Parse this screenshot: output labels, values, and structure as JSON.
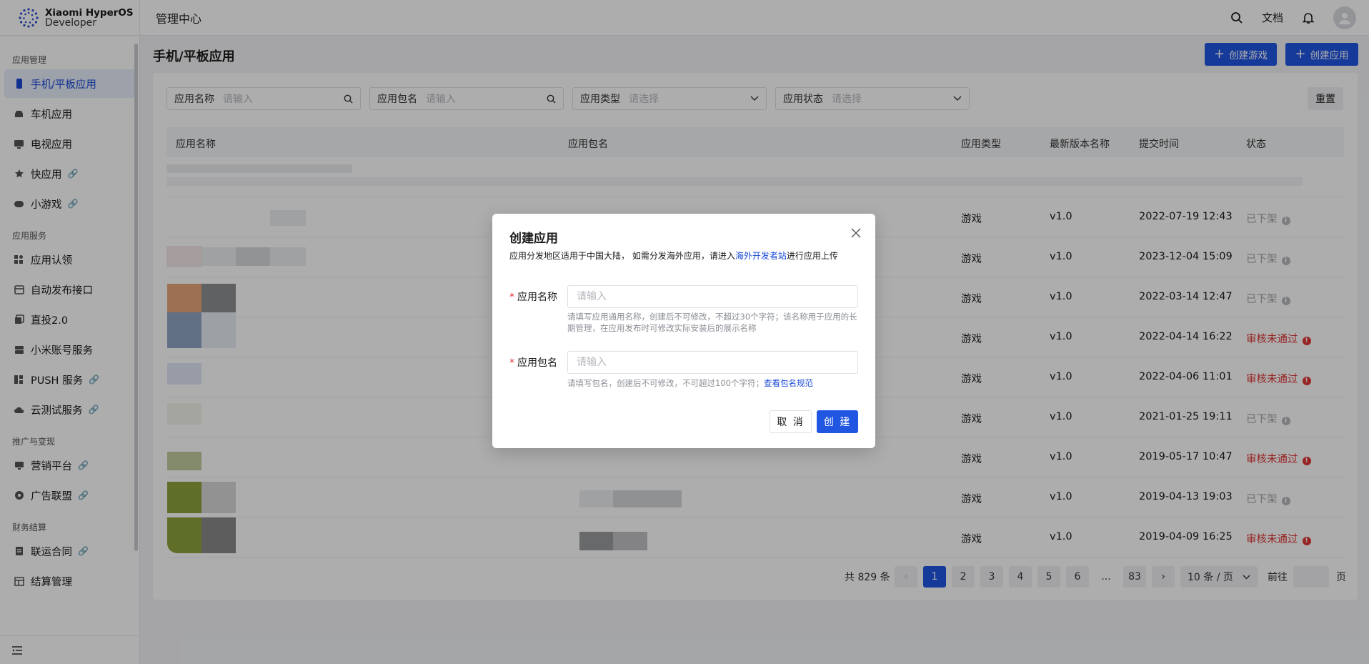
{
  "header": {
    "brand_line1": "Xiaomi HyperOS",
    "brand_line2": "Developer",
    "console_title": "管理中心",
    "docs_label": "文档",
    "icons": [
      "search-icon",
      "bell-icon",
      "avatar-icon"
    ]
  },
  "sidebar": {
    "groups": [
      {
        "title": "应用管理",
        "items": [
          {
            "label": "手机/平板应用",
            "icon": "phone-icon",
            "active": true,
            "external": false
          },
          {
            "label": "车机应用",
            "icon": "car-icon",
            "external": false
          },
          {
            "label": "电视应用",
            "icon": "tv-icon",
            "external": false
          },
          {
            "label": "快应用",
            "icon": "star-icon",
            "external": true
          },
          {
            "label": "小游戏",
            "icon": "gamepad-icon",
            "external": true
          }
        ]
      },
      {
        "title": "应用服务",
        "items": [
          {
            "label": "应用认领",
            "icon": "grid-icon",
            "external": false
          },
          {
            "label": "自动发布接口",
            "icon": "api-icon",
            "external": false
          },
          {
            "label": "直投2.0",
            "icon": "layers-icon",
            "external": false
          },
          {
            "label": "小米账号服务",
            "icon": "account-icon",
            "external": false
          },
          {
            "label": "PUSH 服务",
            "icon": "push-icon",
            "external": true
          },
          {
            "label": "云测试服务",
            "icon": "cloud-icon",
            "external": true
          }
        ]
      },
      {
        "title": "推广与变现",
        "items": [
          {
            "label": "营销平台",
            "icon": "monitor-icon",
            "external": true
          },
          {
            "label": "广告联盟",
            "icon": "ad-icon",
            "external": true
          }
        ]
      },
      {
        "title": "财务结算",
        "items": [
          {
            "label": "联运合同",
            "icon": "contract-icon",
            "external": true
          },
          {
            "label": "结算管理",
            "icon": "table-icon",
            "external": false
          }
        ]
      }
    ]
  },
  "main": {
    "title": "手机/平板应用",
    "create_game": "创建游戏",
    "create_app": "创建应用",
    "filters": {
      "app_name_label": "应用名称",
      "app_name_placeholder": "请输入",
      "package_label": "应用包名",
      "package_placeholder": "请输入",
      "type_label": "应用类型",
      "type_placeholder": "请选择",
      "status_label": "应用状态",
      "status_placeholder": "请选择",
      "reset": "重置"
    },
    "table": {
      "headers": [
        "应用名称",
        "应用包名",
        "应用类型",
        "最新版本名称",
        "提交时间",
        "状态"
      ],
      "rows": [
        {
          "type": "游戏",
          "version": "v1.0",
          "time": "2022-07-19 12:43",
          "status": "已下架",
          "fail": false
        },
        {
          "type": "游戏",
          "version": "v1.0",
          "time": "2023-12-04 15:09",
          "status": "已下架",
          "fail": false
        },
        {
          "type": "游戏",
          "version": "v1.0",
          "time": "2022-03-14 12:47",
          "status": "已下架",
          "fail": false
        },
        {
          "type": "游戏",
          "version": "v1.0",
          "time": "2022-04-14 16:22",
          "status": "审核未通过",
          "fail": true
        },
        {
          "type": "游戏",
          "version": "v1.0",
          "time": "2022-04-06 11:01",
          "status": "审核未通过",
          "fail": true
        },
        {
          "type": "游戏",
          "version": "v1.0",
          "time": "2021-01-25 19:11",
          "status": "已下架",
          "fail": false
        },
        {
          "type": "游戏",
          "version": "v1.0",
          "time": "2019-05-17 10:47",
          "status": "审核未通过",
          "fail": true
        },
        {
          "type": "游戏",
          "version": "v1.0",
          "time": "2019-04-13 19:03",
          "status": "已下架",
          "fail": false
        },
        {
          "type": "游戏",
          "version": "v1.0",
          "time": "2019-04-09 16:25",
          "status": "审核未通过",
          "fail": true
        }
      ]
    },
    "pagination": {
      "total": "共 829 条",
      "pages": [
        "1",
        "2",
        "3",
        "4",
        "5",
        "6",
        "...",
        "83"
      ],
      "current": "1",
      "page_size": "10 条 / 页",
      "goto_prefix": "前往",
      "goto_suffix": "页"
    }
  },
  "modal": {
    "title": "创建应用",
    "desc_before": "应用分发地区适用于中国大陆， 如需分发海外应用，请进入",
    "desc_link": "海外开发者站",
    "desc_after": "进行应用上传",
    "name_label": "应用名称",
    "name_placeholder": "请输入",
    "name_hint": "请填写应用通用名称，创建后不可修改，不超过30个字符；该名称用于应用的长期管理，在应用发布时可修改实际安装后的展示名称",
    "package_label": "应用包名",
    "package_placeholder": "请输入",
    "package_hint": "请填写包名，创建后不可修改，不可超过100个字符；",
    "package_hint_link": "查看包名规范",
    "cancel": "取 消",
    "create": "创 建"
  },
  "colors": {
    "primary": "#2156e3",
    "danger": "#e03434",
    "muted": "#a0a4aa"
  }
}
